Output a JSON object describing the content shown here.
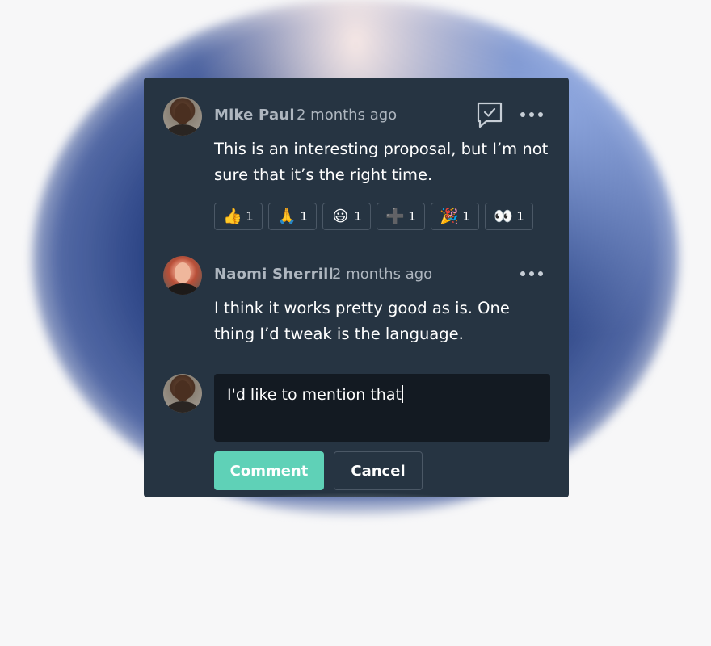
{
  "comments": [
    {
      "author": "Mike Paul",
      "time": "2 months ago",
      "text": "This is an interesting proposal, but I’m not sure that it’s the right time.",
      "reactions": [
        {
          "emoji": "👍",
          "count": "1",
          "icon": "thumbs-up-icon"
        },
        {
          "emoji": "🙏",
          "count": "1",
          "icon": "folded-hands-icon"
        },
        {
          "emoji": "😃",
          "count": "1",
          "icon": "smiley-icon"
        },
        {
          "emoji": "➕",
          "count": "1",
          "icon": "plus-icon"
        },
        {
          "emoji": "🎉",
          "count": "1",
          "icon": "party-popper-icon"
        },
        {
          "emoji": "👀",
          "count": "1",
          "icon": "eyes-icon"
        }
      ]
    },
    {
      "author": "Naomi Sherrill",
      "time": "2 months ago",
      "text": "I think it works pretty good as is. One thing I’d tweak is the language."
    }
  ],
  "composer": {
    "value": "I'd like to mention that",
    "comment_label": "Comment",
    "cancel_label": "Cancel"
  },
  "colors": {
    "panel": "#263442",
    "accent": "#5fd1b7",
    "input": "#131a22"
  }
}
